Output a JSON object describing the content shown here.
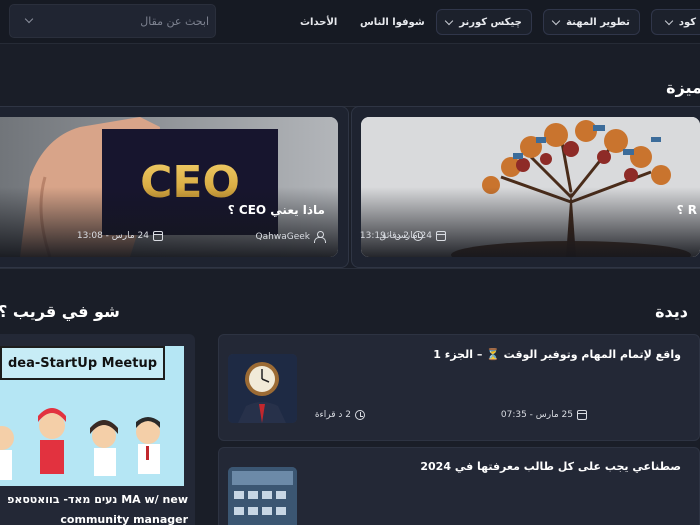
{
  "nav": {
    "item_partial": "كود",
    "career": "تطوير المهنة",
    "geeks_corner": "چيكس كورنر",
    "see_people": "شوفوا الناس",
    "events": "الأحداث",
    "search_placeholder": "ابحث عن مقال"
  },
  "featured": {
    "title": "ميزة",
    "cards": [
      {
        "title": "ماذا يعني CEO ؟",
        "author": "QahwaGeek",
        "date": "24 مارس - 13:08",
        "image_text": "CEO"
      },
      {
        "title": "R ؟",
        "reading_time": "2 دقائق",
        "date": "24 مارس - 13:19"
      }
    ]
  },
  "latest": {
    "title": "ديدة",
    "articles": [
      {
        "title": "واقع لإتمام المهام وتوفير الوقت ⏳ – الجزء 1",
        "date": "25 مارس - 07:35",
        "reading_time": "2 د قراءة"
      },
      {
        "title": "صطناعي يجب على كل طالب معرفتها في 2024",
        "date": "",
        "reading_time": ""
      }
    ]
  },
  "nearby": {
    "title": "شو في قريب ؟",
    "event_banner": "dea-StartUp Meetup",
    "event_line1": "נעים מאד- בוואטסאפ MA w/ new",
    "event_line2": "community manager"
  },
  "colors": {
    "background": "#1a1e28",
    "card": "#232836",
    "accent_event": "#b5e6f4"
  }
}
